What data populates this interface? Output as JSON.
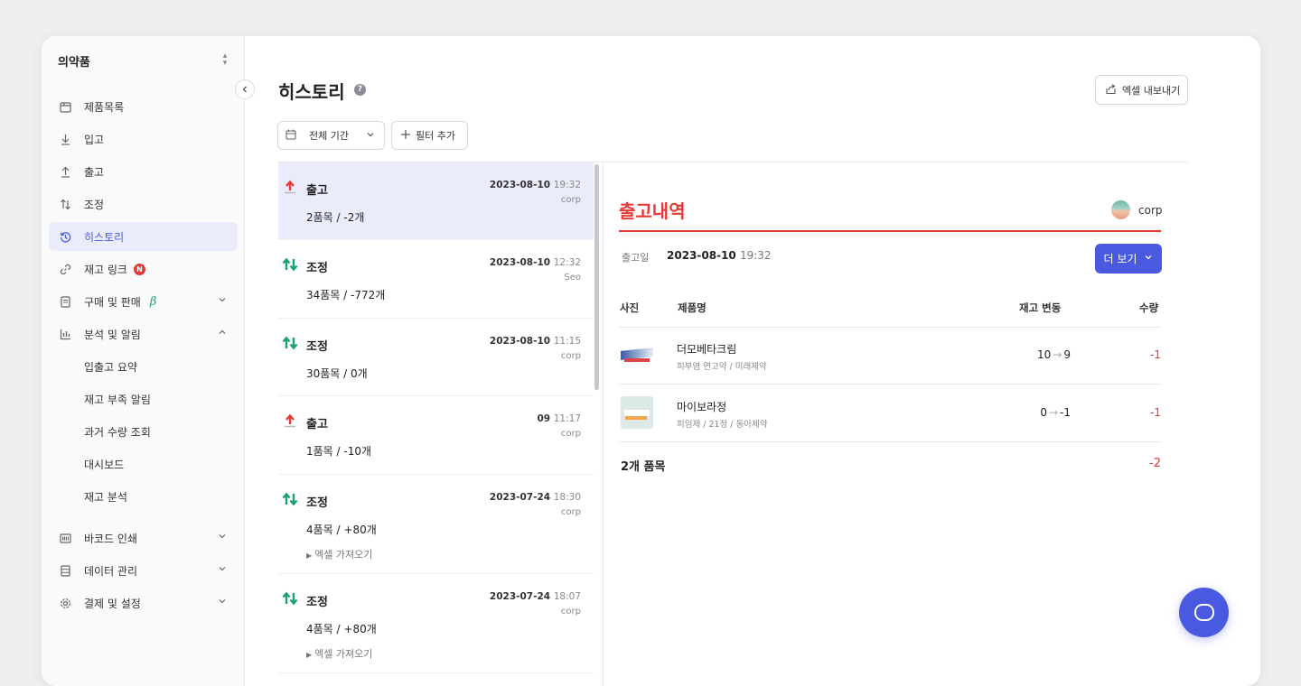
{
  "sidebar": {
    "workspace": "의약품",
    "items": [
      {
        "label": "제품목록",
        "icon": "product-box-icon"
      },
      {
        "label": "입고",
        "icon": "arrow-down-icon"
      },
      {
        "label": "출고",
        "icon": "arrow-up-icon"
      },
      {
        "label": "조정",
        "icon": "adjust-arrows-icon"
      },
      {
        "label": "히스토리",
        "icon": "history-icon",
        "active": true
      },
      {
        "label": "재고 링크",
        "icon": "link-icon",
        "badge": "N"
      },
      {
        "label": "구매 및 판매",
        "icon": "document-icon",
        "tag": "β"
      },
      {
        "label": "분석 및 알림",
        "icon": "chart-icon",
        "expanded": true
      }
    ],
    "analytics_sub": [
      "입출고 요약",
      "재고 부족 알림",
      "과거 수량 조회",
      "대시보드",
      "재고 분석"
    ],
    "bottom_items": [
      {
        "label": "바코드 인쇄",
        "icon": "barcode-icon"
      },
      {
        "label": "데이터 관리",
        "icon": "database-icon"
      },
      {
        "label": "결제 및 설정",
        "icon": "gear-icon"
      }
    ]
  },
  "header": {
    "title": "히스토리",
    "export_label": "엑셀 내보내기",
    "period_label": "전체 기간",
    "filter_label": "필터 추가"
  },
  "history": [
    {
      "kind": "출고",
      "type": "out",
      "summary": "2품목 / -2개",
      "date": "2023-08-10",
      "time": "19:32",
      "user": "corp",
      "selected": true
    },
    {
      "kind": "조정",
      "type": "adjust",
      "summary": "34품목 / -772개",
      "date": "2023-08-10",
      "time": "12:32",
      "user": "Seo"
    },
    {
      "kind": "조정",
      "type": "adjust",
      "summary": "30품목 / 0개",
      "date": "2023-08-10",
      "time": "11:15",
      "user": "corp"
    },
    {
      "kind": "출고",
      "type": "out",
      "summary": "1품목 / -10개",
      "date": "09",
      "time": "11:17",
      "user": "corp"
    },
    {
      "kind": "조정",
      "type": "adjust",
      "summary": "4품목 / +80개",
      "date": "2023-07-24",
      "time": "18:30",
      "user": "corp",
      "link": "엑셀 가져오기"
    },
    {
      "kind": "조정",
      "type": "adjust",
      "summary": "4품목 / +80개",
      "date": "2023-07-24",
      "time": "18:07",
      "user": "corp",
      "link": "엑셀 가져오기"
    }
  ],
  "detail": {
    "title": "출고내역",
    "user": "corp",
    "date_label": "출고일",
    "date": "2023-08-10",
    "time": "19:32",
    "more_label": "더 보기",
    "columns": {
      "photo": "사진",
      "name": "제품명",
      "stock": "재고 변동",
      "qty": "수량"
    },
    "rows": [
      {
        "name": "더모베타크림",
        "desc": "피부염 연고약 / 미래제약",
        "from": "10",
        "to": "9",
        "qty": "-1"
      },
      {
        "name": "마이보라정",
        "desc": "피임제 / 21정 / 동아제약",
        "from": "0",
        "to": "-1",
        "qty": "-1"
      }
    ],
    "total_label": "2개 품목",
    "total_qty": "-2"
  },
  "colors": {
    "accent": "#4a5ae0",
    "out": "#e53935",
    "adjust": "#18a07a"
  }
}
